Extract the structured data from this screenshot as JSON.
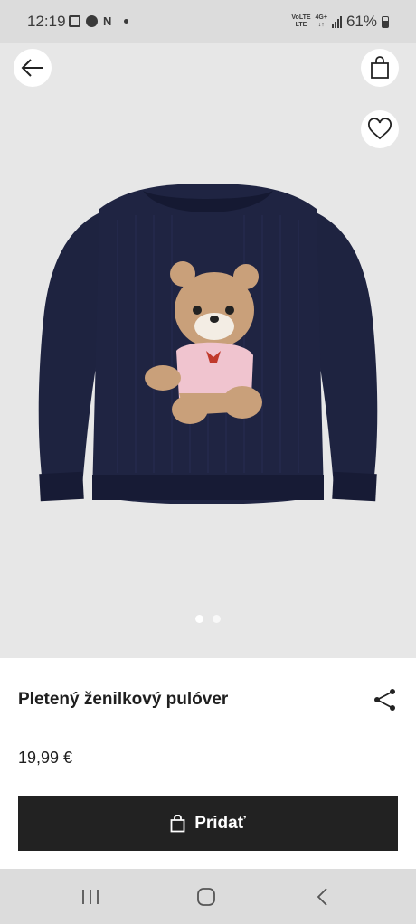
{
  "status_bar": {
    "time": "12:19",
    "network_top": "VoLTE",
    "network_bottom": "LTE",
    "data_top": "4G+",
    "data_bottom": "↓↑",
    "battery": "61%",
    "left_icons": [
      "gallery-icon",
      "facebook-icon",
      "notification-n-icon",
      "dot-icon"
    ]
  },
  "header": {
    "back_icon": "arrow-left-icon",
    "bag_icon": "shopping-bag-icon",
    "favorite_icon": "heart-icon"
  },
  "gallery": {
    "image": "navy-knit-sweater-with-teddy-bear",
    "dots_total": 2,
    "dots_active": 1
  },
  "product": {
    "title": "Pletený ženilkový pulóver",
    "price": "19,99 €",
    "share_icon": "share-icon"
  },
  "actions": {
    "add_label": "Pridať",
    "add_icon": "shopping-bag-icon"
  },
  "system_nav": {
    "items": [
      "recent-apps-icon",
      "home-icon",
      "back-icon"
    ]
  },
  "colors": {
    "hero_bg": "#e7e7e7",
    "button_bg": "#222222",
    "button_text": "#ffffff",
    "sweater": "#1e2340",
    "bear": "#c9a07a",
    "bear_shirt": "#f0c4cf"
  }
}
